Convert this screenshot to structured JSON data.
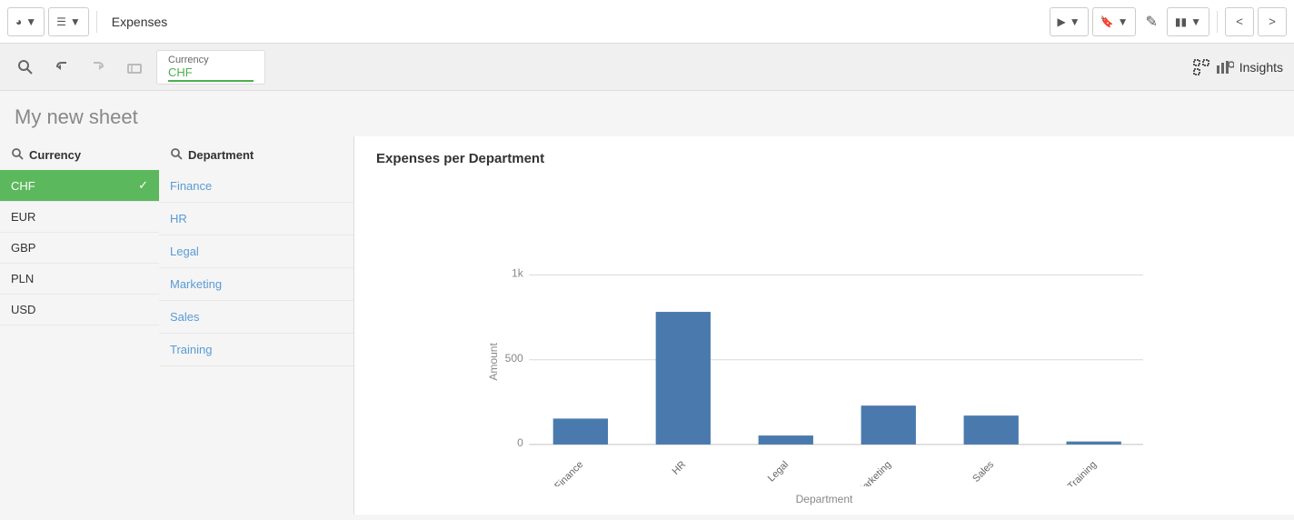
{
  "app": {
    "name": "Expenses"
  },
  "toolbar": {
    "present_label": "",
    "bookmark_label": "",
    "edit_label": "",
    "chart_label": "",
    "nav_prev": "<",
    "nav_next": ">",
    "insights_label": "Insights"
  },
  "filter": {
    "currency_label": "Currency",
    "currency_value": "CHF"
  },
  "sheet": {
    "title": "My new sheet"
  },
  "currency_panel": {
    "header": "Currency",
    "items": [
      {
        "label": "CHF",
        "selected": true
      },
      {
        "label": "EUR",
        "selected": false
      },
      {
        "label": "GBP",
        "selected": false
      },
      {
        "label": "PLN",
        "selected": false
      },
      {
        "label": "USD",
        "selected": false
      }
    ]
  },
  "department_panel": {
    "header": "Department",
    "items": [
      {
        "label": "Finance"
      },
      {
        "label": "HR"
      },
      {
        "label": "Legal"
      },
      {
        "label": "Marketing"
      },
      {
        "label": "Sales"
      },
      {
        "label": "Training"
      }
    ]
  },
  "chart": {
    "title": "Expenses per Department",
    "x_label": "Department",
    "y_label": "Amount",
    "y_ticks": [
      "0",
      "500",
      "1k"
    ],
    "bars": [
      {
        "dept": "Finance",
        "value": 150,
        "max": 1000
      },
      {
        "dept": "HR",
        "value": 780,
        "max": 1000
      },
      {
        "dept": "Legal",
        "value": 55,
        "max": 1000
      },
      {
        "dept": "Marketing",
        "value": 230,
        "max": 1000
      },
      {
        "dept": "Sales",
        "value": 170,
        "max": 1000
      },
      {
        "dept": "Training",
        "value": 18,
        "max": 1000
      }
    ],
    "bar_color": "#4a7aad"
  }
}
